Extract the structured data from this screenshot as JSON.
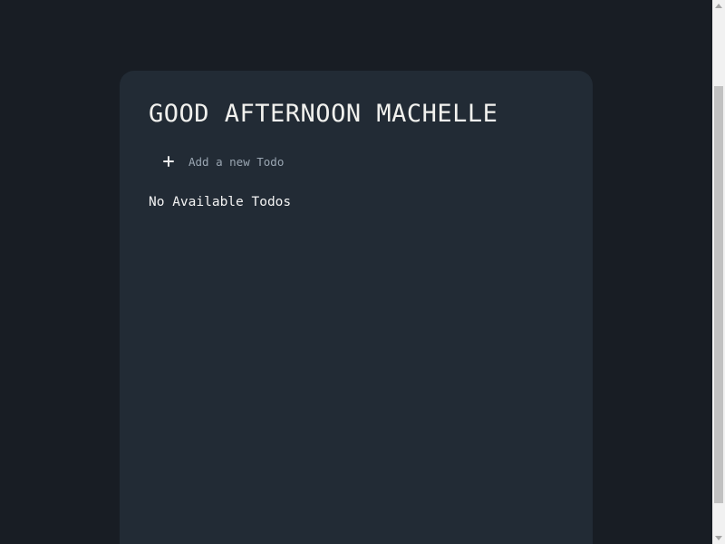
{
  "greeting": {
    "title": "GOOD AFTERNOON MACHELLE"
  },
  "add_todo": {
    "icon": "plus-icon",
    "placeholder": "Add a new Todo",
    "value": ""
  },
  "todos": {
    "items": [],
    "empty_message": "No Available Todos"
  },
  "colors": {
    "background": "#181d24",
    "card": "#222b35",
    "title_text": "#f1f1ee",
    "placeholder_text": "#9aa6b2",
    "scrollbar_track": "#f1f1f1",
    "scrollbar_thumb": "#c1c1c1"
  }
}
